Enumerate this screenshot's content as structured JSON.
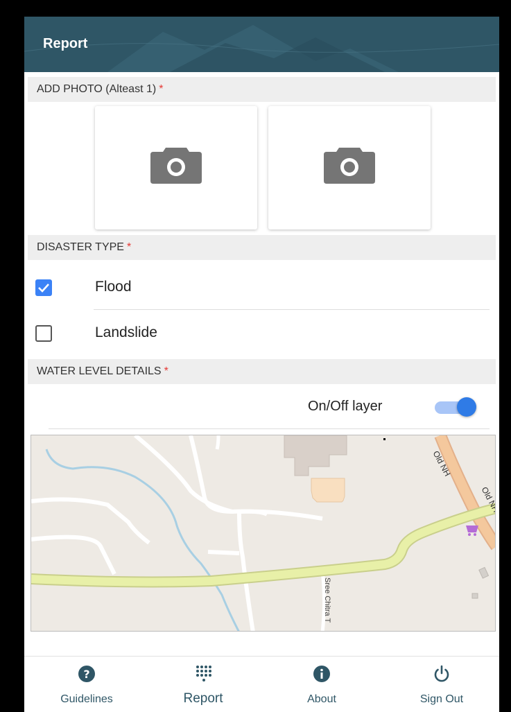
{
  "appbar": {
    "title": "Report"
  },
  "photos": {
    "header": "ADD PHOTO (Alteast 1)",
    "required_mark": "*",
    "tiles": [
      {
        "icon": "camera-icon"
      },
      {
        "icon": "camera-icon"
      }
    ]
  },
  "disaster_type": {
    "header": "DISASTER TYPE",
    "required_mark": "*",
    "options": [
      {
        "label": "Flood",
        "checked": true
      },
      {
        "label": "Landslide",
        "checked": false
      }
    ]
  },
  "water_level": {
    "header": "WATER LEVEL DETAILS",
    "required_mark": "*",
    "toggle_label": "On/Off layer",
    "toggle_on": true
  },
  "map": {
    "road_labels": [
      "Old NH",
      "Old NH",
      "Sree Chitra T"
    ]
  },
  "bottom_nav": {
    "items": [
      {
        "label": "Guidelines",
        "icon": "help-icon"
      },
      {
        "label": "Report",
        "icon": "dots-grid-icon",
        "active": true
      },
      {
        "label": "About",
        "icon": "info-icon"
      },
      {
        "label": "Sign Out",
        "icon": "power-icon"
      }
    ]
  },
  "colors": {
    "appbar": "#2f5666",
    "accent": "#3b82f6",
    "required": "#e53935",
    "road": "#e8f0a8"
  }
}
